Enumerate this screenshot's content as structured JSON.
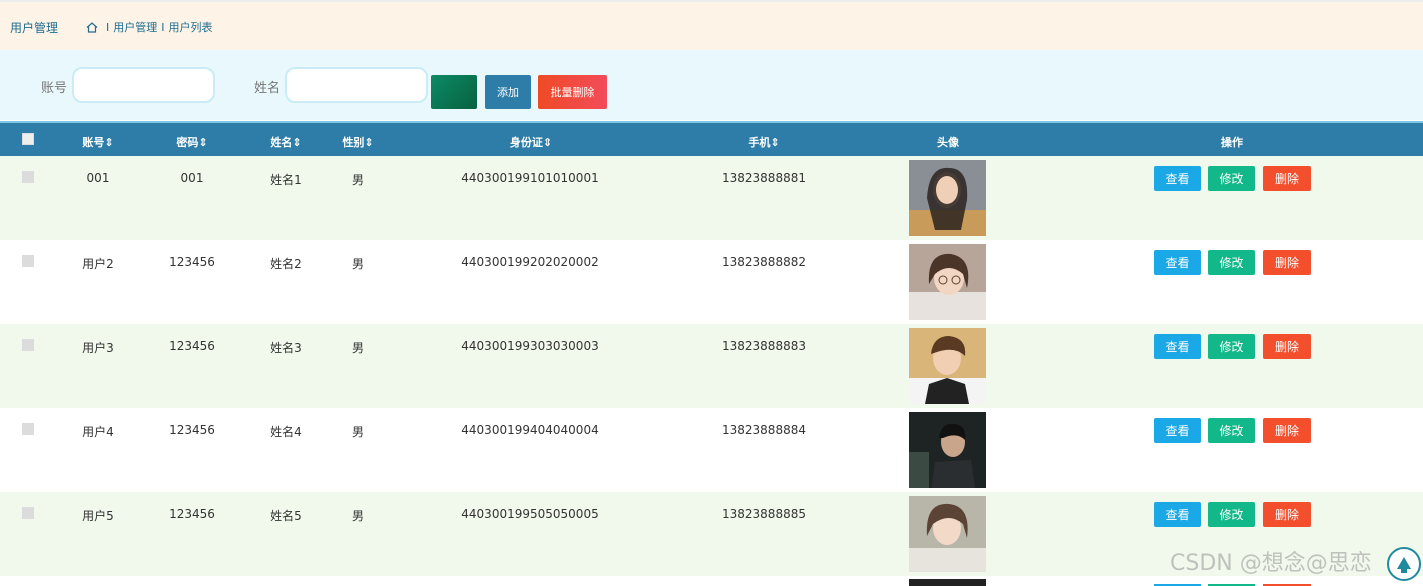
{
  "header": {
    "title": "用户管理",
    "breadcrumb": [
      "用户管理",
      "用户列表"
    ],
    "sep": "I"
  },
  "search": {
    "account_label": "账号",
    "name_label": "姓名",
    "search_button": "",
    "add_button": "添加",
    "batch_delete_button": "批量删除"
  },
  "table": {
    "columns": [
      "账号",
      "密码",
      "姓名",
      "性别",
      "身份证",
      "手机",
      "头像",
      "操作"
    ],
    "rows": [
      {
        "account": "001",
        "password": "001",
        "name": "姓名1",
        "gender": "男",
        "id_card": "440300199101010001",
        "phone": "13823888881"
      },
      {
        "account": "用户2",
        "password": "123456",
        "name": "姓名2",
        "gender": "男",
        "id_card": "440300199202020002",
        "phone": "13823888882"
      },
      {
        "account": "用户3",
        "password": "123456",
        "name": "姓名3",
        "gender": "男",
        "id_card": "440300199303030003",
        "phone": "13823888883"
      },
      {
        "account": "用户4",
        "password": "123456",
        "name": "姓名4",
        "gender": "男",
        "id_card": "440300199404040004",
        "phone": "13823888884"
      },
      {
        "account": "用户5",
        "password": "123456",
        "name": "姓名5",
        "gender": "男",
        "id_card": "440300199505050005",
        "phone": "13823888885"
      }
    ],
    "actions": {
      "view": "查看",
      "edit": "修改",
      "delete": "删除"
    }
  },
  "watermark": "CSDN @想念@思恋",
  "colors": {
    "header_bg": "#fdf3e6",
    "table_head": "#2d7da8",
    "row_alt": "#f1f8ec",
    "view": "#1aa8e6",
    "edit": "#12b88a",
    "delete": "#f34f2c"
  }
}
